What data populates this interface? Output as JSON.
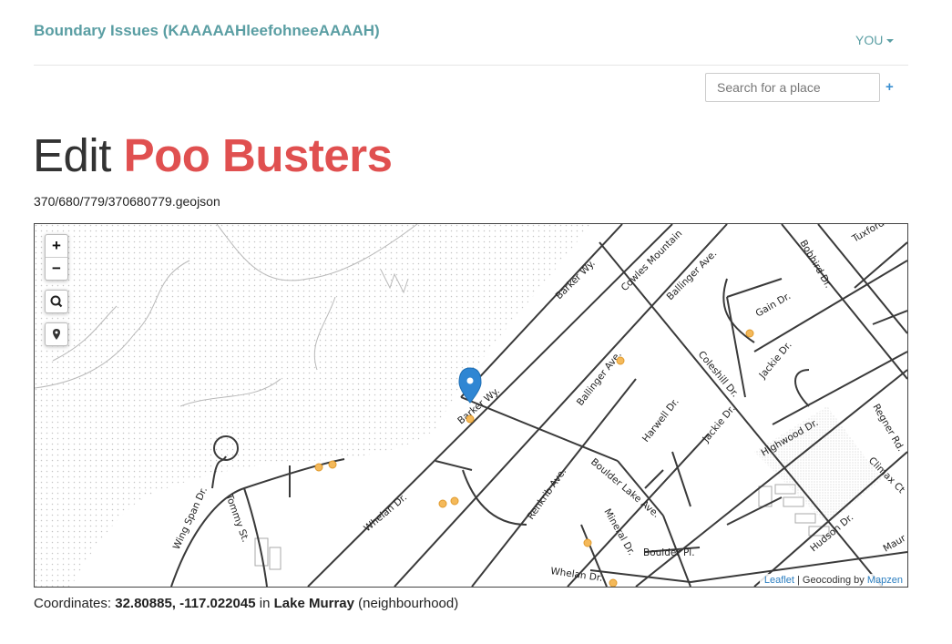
{
  "header": {
    "brand": "Boundary Issues (KAAAAAHleefohneeAAAAH)",
    "user_menu": "YOU"
  },
  "search": {
    "placeholder": "Search for a place",
    "add_label": "+"
  },
  "page": {
    "title_prefix": "Edit",
    "title_name": "Poo Busters",
    "file_path": "370/680/779/370680779.geojson"
  },
  "map": {
    "controls": {
      "zoom_in": "+",
      "zoom_out": "−"
    },
    "streets": [
      "Barker Wy.",
      "Cowles Mountain",
      "Ballinger Ave.",
      "Bobhird Dr.",
      "Tuxford",
      "Gain Dr.",
      "Jackie Dr.",
      "Coleshill Dr.",
      "Ballinger Ave.",
      "Barker Wy.",
      "Harwell Dr.",
      "Jackie Dr.",
      "Regner Rd.",
      "Highwood Dr.",
      "Climax Ct",
      "Boulder Lake Ave.",
      "Renkrib Ave.",
      "Mineral Dr.",
      "Boulder Pl.",
      "Whelan Dr.",
      "Whelan Dr.",
      "Wing Span Dr.",
      "Tommy St.",
      "Hudson Dr.",
      "Maur"
    ],
    "attribution": {
      "leaflet": "Leaflet",
      "separator": " | Geocoding by ",
      "provider": "Mapzen"
    }
  },
  "coordinates": {
    "label": "Coordinates:",
    "value": "32.80885, -117.022045",
    "in_text": "in",
    "place": "Lake Murray",
    "placetype": "(neighbourhood)"
  }
}
